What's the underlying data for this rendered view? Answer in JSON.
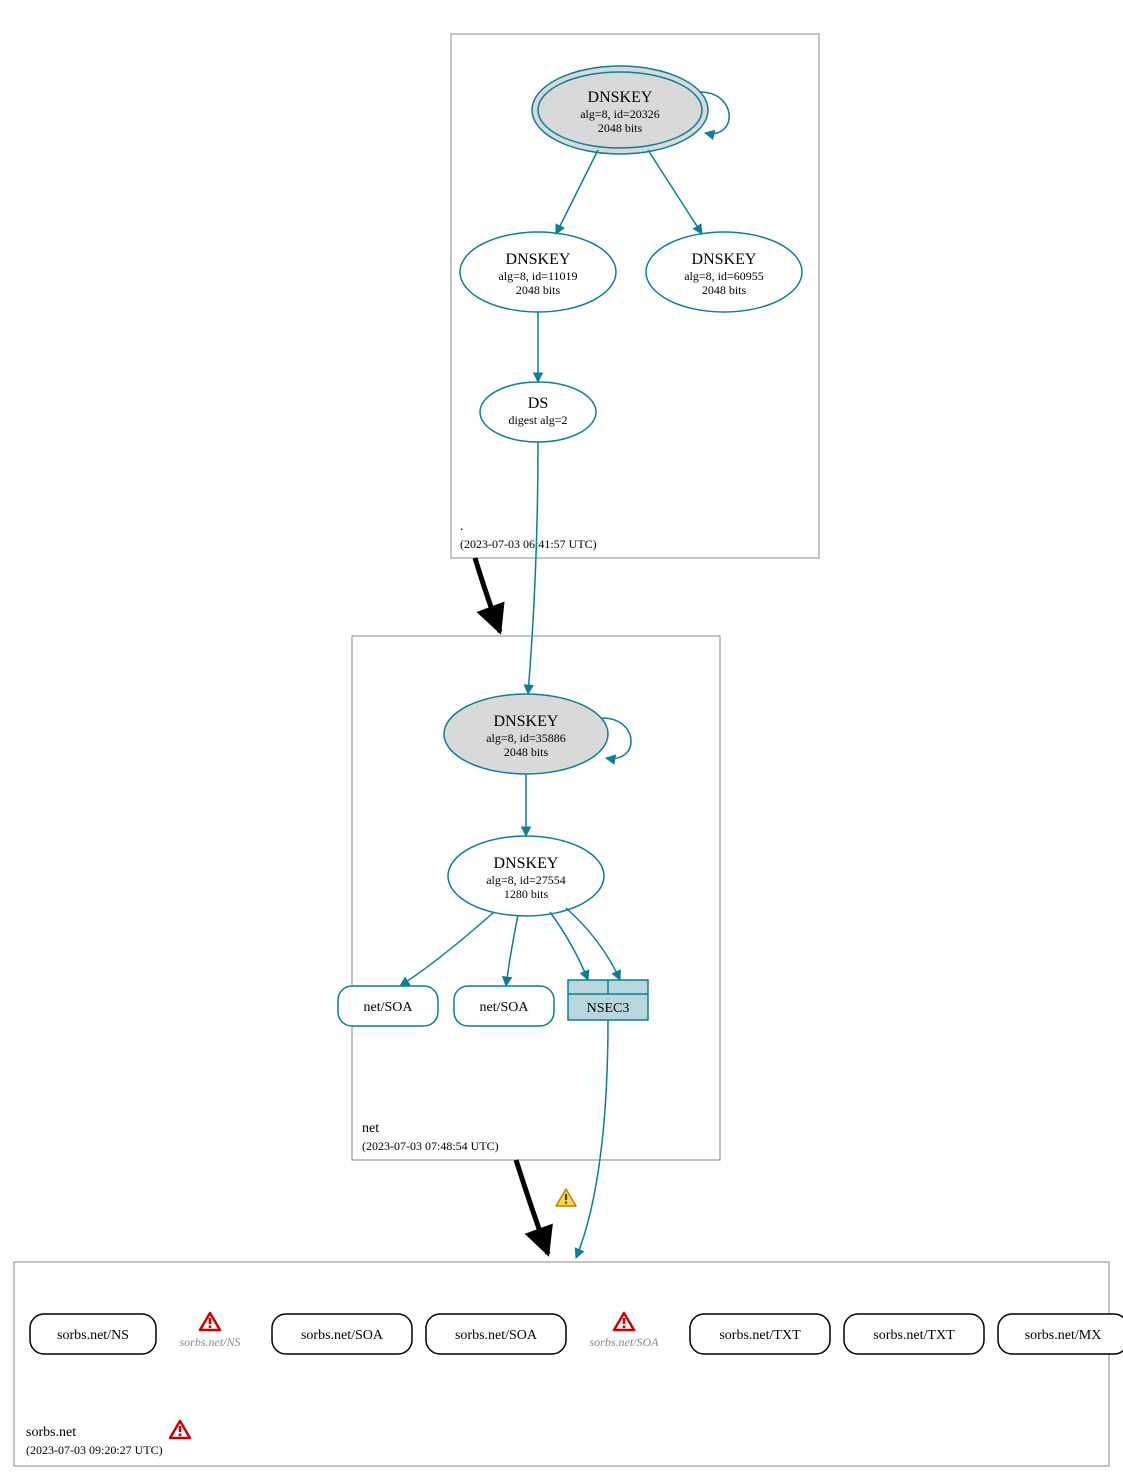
{
  "colors": {
    "teal": "#097f98",
    "grey_fill": "#d9d9d9",
    "nsec3_fill": "#b8d6dc"
  },
  "zones": {
    "root": {
      "label": ".",
      "timestamp": "(2023-07-03 06:41:57 UTC)"
    },
    "net": {
      "label": "net",
      "timestamp": "(2023-07-03 07:48:54 UTC)"
    },
    "sorbs": {
      "label": "sorbs.net",
      "timestamp": "(2023-07-03 09:20:27 UTC)"
    }
  },
  "nodes": {
    "root_ksk": {
      "title": "DNSKEY",
      "line2": "alg=8, id=20326",
      "line3": "2048 bits"
    },
    "root_zsk1": {
      "title": "DNSKEY",
      "line2": "alg=8, id=11019",
      "line3": "2048 bits"
    },
    "root_zsk2": {
      "title": "DNSKEY",
      "line2": "alg=8, id=60955",
      "line3": "2048 bits"
    },
    "root_ds": {
      "title": "DS",
      "line2": "digest alg=2"
    },
    "net_ksk": {
      "title": "DNSKEY",
      "line2": "alg=8, id=35886",
      "line3": "2048 bits"
    },
    "net_zsk": {
      "title": "DNSKEY",
      "line2": "alg=8, id=27554",
      "line3": "1280 bits"
    },
    "net_soa1": {
      "label": "net/SOA"
    },
    "net_soa2": {
      "label": "net/SOA"
    },
    "net_nsec3": {
      "label": "NSEC3"
    },
    "sorbs_ns": {
      "label": "sorbs.net/NS"
    },
    "sorbs_ns_warn": {
      "label": "sorbs.net/NS"
    },
    "sorbs_soa1": {
      "label": "sorbs.net/SOA"
    },
    "sorbs_soa2": {
      "label": "sorbs.net/SOA"
    },
    "sorbs_soa_warn": {
      "label": "sorbs.net/SOA"
    },
    "sorbs_txt1": {
      "label": "sorbs.net/TXT"
    },
    "sorbs_txt2": {
      "label": "sorbs.net/TXT"
    },
    "sorbs_mx": {
      "label": "sorbs.net/MX"
    }
  },
  "icons": {
    "warning": "warning-icon"
  }
}
